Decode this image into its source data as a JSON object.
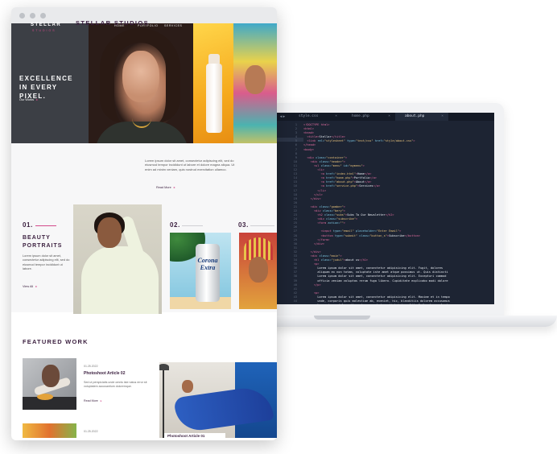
{
  "editor": {
    "tabs": [
      "style.css",
      "home.php",
      "about.php"
    ],
    "active_tab": 2,
    "close_glyph": "×",
    "arrows_glyph": "◂ ▸",
    "line_numbers": [
      "1",
      "2",
      "3",
      "4",
      "5",
      "6",
      "7",
      "8",
      "9",
      "10",
      "11",
      "12",
      "13",
      "14",
      "15",
      "16",
      "17",
      "18",
      "19",
      "20",
      "21",
      "22",
      "23",
      "24",
      "25",
      "26",
      "27",
      "28",
      "29",
      "30",
      "31",
      "32",
      "33",
      "34",
      "35",
      "36",
      "37",
      "38",
      "39",
      "40",
      "41",
      "42",
      "43",
      "44"
    ]
  },
  "site": {
    "logo": "STELLAR",
    "logo_sub": "STUDIOS",
    "nav": [
      "HOME",
      "PORTFOLIO",
      "SERVICES"
    ],
    "hero_title": "EXCELLENCE IN EVERY PIXEL.",
    "hero_link": "Our Works",
    "intro_title": "STELLAR STUDIOS",
    "intro_text": "Lorem ipsum dolor sit amet, consectetur adipiscing elit, sed do eiusmod tempor incididunt ut labore et dolore magna aliqua. Ut enim ad minim veniam, quis nostrud exercitation ullamco.",
    "intro_more": "Read More",
    "services": {
      "num_1": "01.",
      "num_2": "02.",
      "num_3": "03.",
      "title_1": "BEAUTY PORTRAITS",
      "text_1": "Lorem ipsum dolor sit amet, consectetur adipiscing elit, sed do eiusmod tempor incididunt ut labore.",
      "more_1": "View All"
    },
    "can_brand": "Corona Extra",
    "featured_title": "FEATURED WORK",
    "article_1": {
      "date": "01.25.2022",
      "title": "Photoshoot Article 02",
      "text": "Sed ut perspiciatis unde omnis iste natus error sit voluptatem accusantium doloremque.",
      "more": "Read More"
    },
    "article_2_caption": "Photoshoot Article 01",
    "article_3_date": "01.25.2022",
    "arrow_glyph": "▸"
  }
}
